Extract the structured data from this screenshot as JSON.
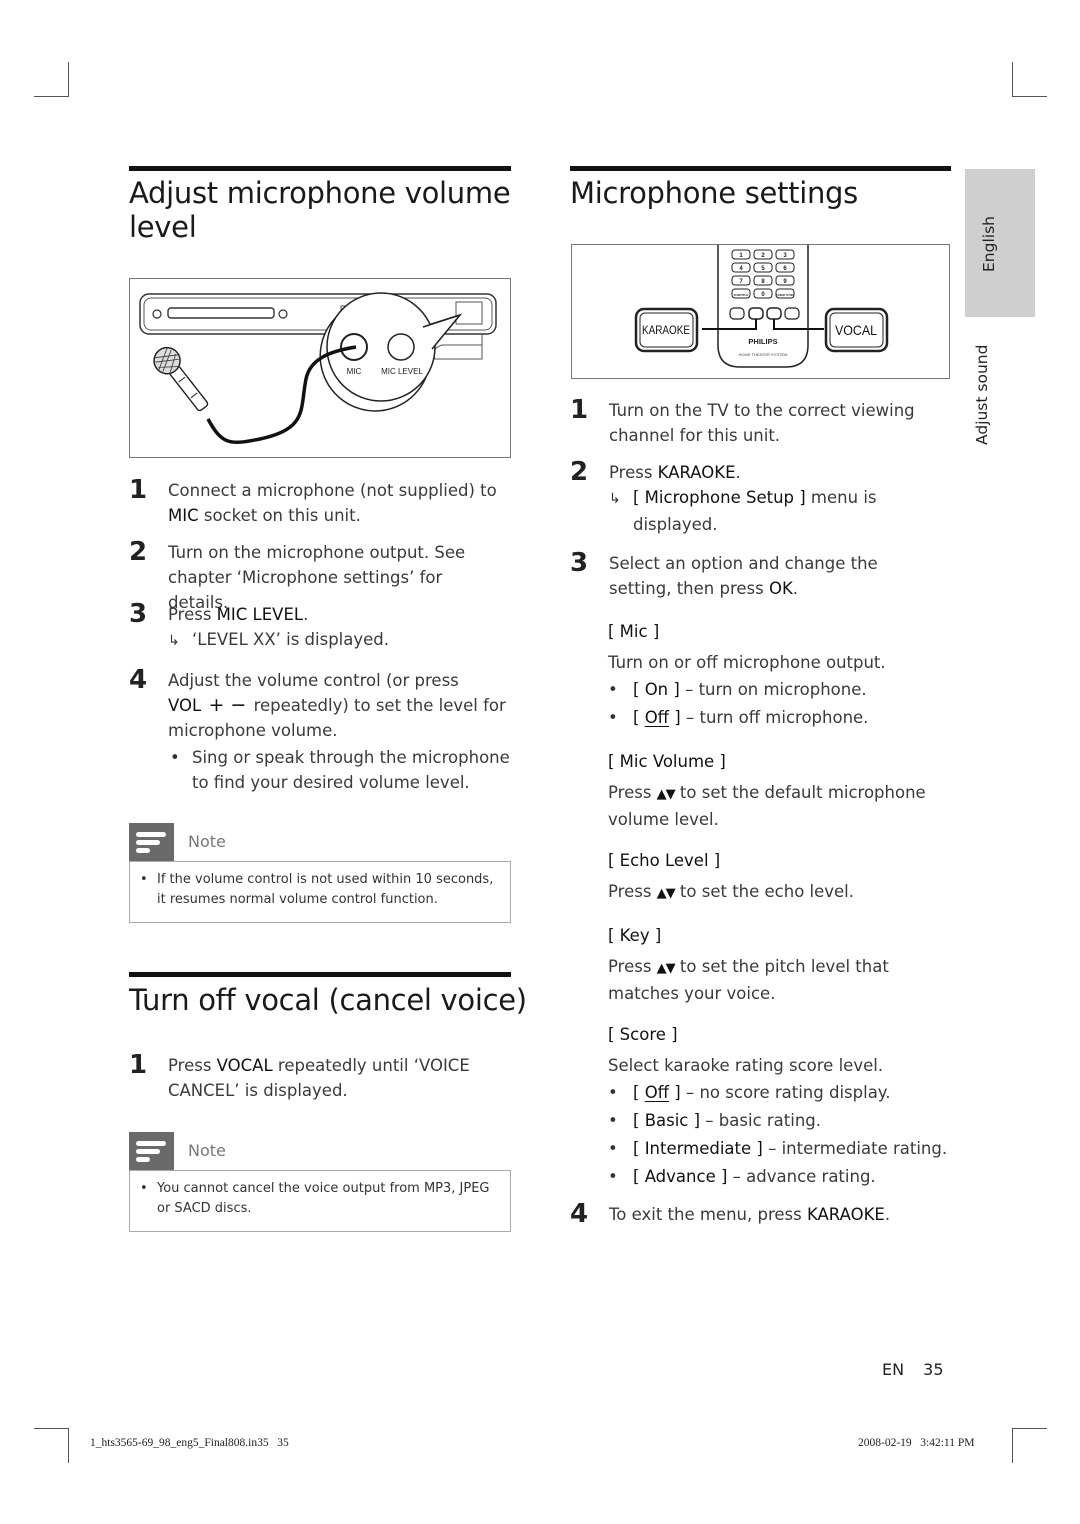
{
  "left_column": {
    "section1": {
      "title_line1": "Adjust microphone volume",
      "title_line2": "level",
      "figure": {
        "label_mic": "MIC",
        "label_mic_level": "MIC LEVEL"
      },
      "steps": [
        {
          "num": "1",
          "text_a": "Connect a microphone (not supplied) to",
          "bold": "MIC",
          "text_b": " socket on this unit."
        },
        {
          "num": "2",
          "text": "Turn on the microphone output. See chapter ‘Microphone settings’ for details."
        },
        {
          "num": "3",
          "text_a": "Press ",
          "bold": "MIC LEVEL",
          "text_b": ".",
          "result": "‘LEVEL XX’ is displayed."
        },
        {
          "num": "4",
          "text_a": "Adjust the volume control (or press",
          "bold": "VOL",
          "symbols": "+ −",
          "text_b": "repeatedly) to set the level for microphone volume.",
          "bullet": "Sing or speak through the microphone to find your desired volume level."
        }
      ],
      "note": {
        "label": "Note",
        "text": "If the volume control is not used within 10 seconds, it resumes normal volume control function."
      }
    },
    "section2": {
      "title": "Turn off vocal (cancel voice)",
      "steps": [
        {
          "num": "1",
          "text_a": "Press ",
          "bold": "VOCAL",
          "text_b": " repeatedly until ‘VOICE CANCEL’ is displayed."
        }
      ],
      "note": {
        "label": "Note",
        "text": "You cannot cancel the voice output from MP3, JPEG or SACD discs."
      }
    }
  },
  "right_column": {
    "title": "Microphone settings",
    "figure": {
      "karaoke_button": "KARAOKE",
      "vocal_button": "VOCAL",
      "brand": "PHILIPS",
      "brand_sub": "HOME THEATER SYSTEM",
      "keypad": [
        "1",
        "2",
        "3",
        "4",
        "5",
        "6",
        "7",
        "8",
        "9",
        "SUBTITLE",
        "0",
        "AUDIO SYNC"
      ]
    },
    "steps": [
      {
        "num": "1",
        "text": "Turn on the TV to the correct viewing channel for this unit."
      },
      {
        "num": "2",
        "text_a": "Press ",
        "bold": "KARAOKE",
        "text_b": ".",
        "result_bold": "[ Microphone Setup ]",
        "result_text": " menu is displayed."
      },
      {
        "num": "3",
        "text_a": "Select an option and change the setting, then press ",
        "bold": "OK",
        "text_b": "."
      },
      {
        "num": "4",
        "text_a": "To exit the menu, press ",
        "bold": "KARAOKE",
        "text_b": "."
      }
    ],
    "options": [
      {
        "title": "[ Mic ]",
        "desc": "Turn on or off microphone output.",
        "items": [
          {
            "pre": "[ ",
            "name": "On",
            "post": " ]",
            "desc": " – turn on microphone.",
            "default": false
          },
          {
            "pre": "[ ",
            "name": "Off",
            "post": " ]",
            "desc": " – turn off microphone.",
            "default": true
          }
        ]
      },
      {
        "title": "[ Mic Volume ]",
        "desc_a": "Press ",
        "arrows": "▲▼",
        "desc_b": " to set the default microphone volume level."
      },
      {
        "title": "[ Echo Level ]",
        "desc_a": "Press ",
        "arrows": "▲▼",
        "desc_b": " to set the echo level."
      },
      {
        "title": "[ Key ]",
        "desc_a": "Press ",
        "arrows": "▲▼",
        "desc_b": " to set the pitch level that matches your voice."
      },
      {
        "title": "[ Score ]",
        "desc": "Select karaoke rating score level.",
        "items": [
          {
            "pre": "[ ",
            "name": "Off",
            "post": " ]",
            "desc": " – no score rating display.",
            "default": true
          },
          {
            "pre": "[ ",
            "name": "Basic",
            "post": " ]",
            "desc": " – basic rating.",
            "default": false
          },
          {
            "pre": "[ ",
            "name": "Intermediate",
            "post": " ]",
            "desc": " – intermediate rating.",
            "default": false
          },
          {
            "pre": "[ ",
            "name": "Advance",
            "post": " ]",
            "desc": " – advance rating.",
            "default": false
          }
        ]
      }
    ]
  },
  "side_tabs": {
    "active": "English",
    "chapter": "Adjust sound"
  },
  "footer": {
    "lang": "EN",
    "page": "35",
    "slug_left": "1_hts3565-69_98_eng5_Final808.in35   35",
    "slug_right": "2008-02-19   3:42:11 PM"
  },
  "colors": {
    "note_icon": "#6a6a6a",
    "side_tab": "#cfcfcf",
    "rule": "#111111"
  }
}
